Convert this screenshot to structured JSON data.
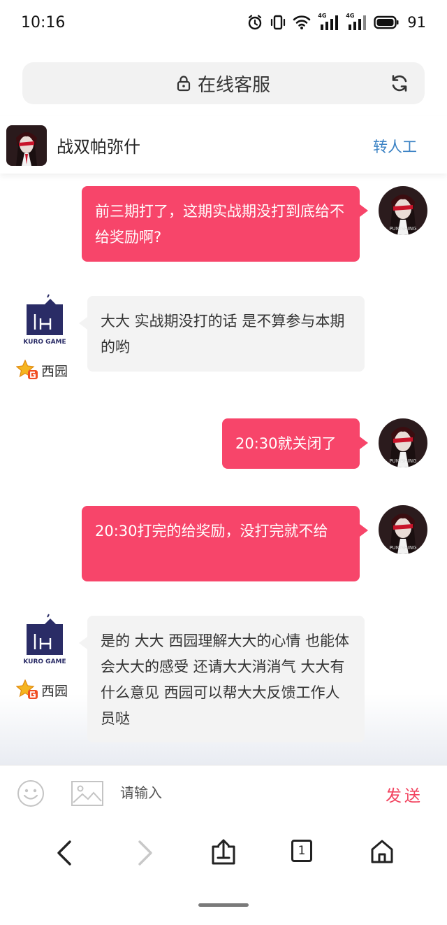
{
  "status_bar": {
    "time": "10:16",
    "network_1": "4G",
    "network_2": "4G",
    "battery": "91"
  },
  "url_bar": {
    "title": "在线客服"
  },
  "chat_header": {
    "name": "战双帕弥什",
    "transfer_label": "转人工"
  },
  "agent": {
    "name": "西园",
    "logo_text": "KURO GAME"
  },
  "user": {
    "avatar_text": "PUNISHING"
  },
  "messages": [
    {
      "side": "user",
      "text": "前三期打了，这期实战期没打到底给不给奖励啊?"
    },
    {
      "side": "agent",
      "text": "大大 实战期没打的话 是不算参与本期的哟"
    },
    {
      "side": "user",
      "text": "20:30就关闭了"
    },
    {
      "side": "user",
      "text": "20:30打完的给奖励，没打完就不给"
    },
    {
      "side": "agent",
      "text": "是的 大大 西园理解大大的心情 也能体会大大的感受 还请大大消消气 大大有什么意见 西园可以帮大大反馈工作人员哒"
    }
  ],
  "input_bar": {
    "placeholder": "请输入",
    "send_label": "发送"
  },
  "browser_nav": {
    "tabs_count": "1"
  },
  "colors": {
    "accent": "#f7456a",
    "link": "#3b82c4",
    "agent_bubble": "#f3f3f3"
  }
}
